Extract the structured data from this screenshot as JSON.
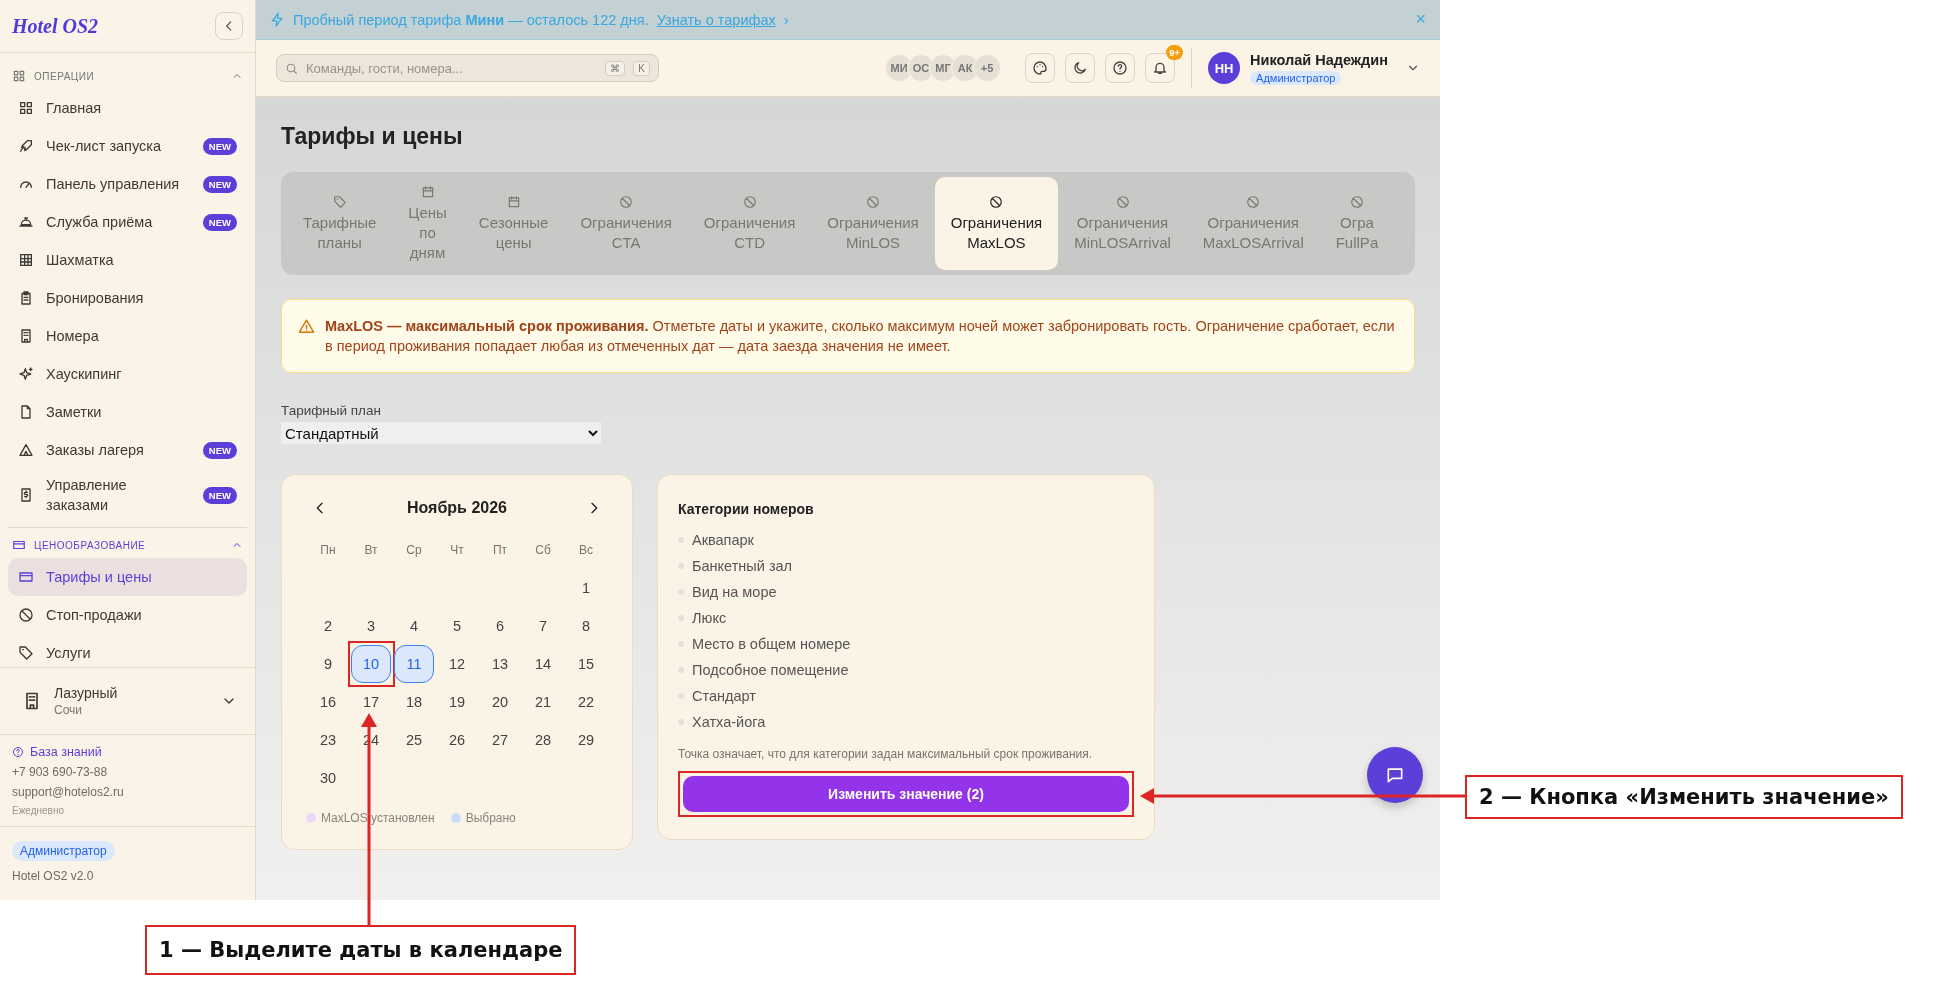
{
  "sidebar": {
    "logo": "Hotel OS2",
    "sections": [
      {
        "title": "ОПЕРАЦИИ",
        "expanded": true,
        "items": [
          {
            "label": "Главная",
            "selected": false
          },
          {
            "label": "Чек-лист запуска",
            "badge": "NEW",
            "selected": false
          },
          {
            "label": "Панель управления",
            "badge": "NEW",
            "selected": false
          },
          {
            "label": "Служба приёма",
            "badge": "NEW",
            "selected": false
          },
          {
            "label": "Шахматка",
            "selected": false
          },
          {
            "label": "Бронирования",
            "selected": false
          },
          {
            "label": "Номера",
            "selected": false
          },
          {
            "label": "Хаускипинг",
            "selected": false
          },
          {
            "label": "Заметки",
            "selected": false
          },
          {
            "label": "Заказы лагеря",
            "badge": "NEW",
            "selected": false
          },
          {
            "label": "Управление заказами",
            "badge": "NEW",
            "selected": false
          }
        ]
      },
      {
        "title": "ЦЕНООБРАЗОВАНИЕ",
        "expanded": true,
        "items": [
          {
            "label": "Тарифы и цены",
            "selected": true
          },
          {
            "label": "Стоп-продажи",
            "selected": false
          },
          {
            "label": "Услуги",
            "selected": false
          }
        ]
      }
    ],
    "property": {
      "name": "Лазурный",
      "city": "Сочи"
    },
    "help": {
      "link": "База знаний",
      "phone": "+7 903 690-73-88",
      "email": "support@hotelos2.ru",
      "hours": "Ежедневно"
    },
    "footer": {
      "role": "Администратор",
      "version": "Hotel OS2 v2.0"
    }
  },
  "banner": {
    "text": "Пробный период тарифа **Мини** — осталось 122 дня.",
    "link": "Узнать о тарифах",
    "link_arrow": "›",
    "close": "×"
  },
  "topbar": {
    "search": {
      "placeholder": "Команды, гости, номера..."
    },
    "keys": [
      "⌘",
      "K"
    ],
    "avatars": [
      "МИ",
      "ОС",
      "МГ",
      "АК",
      "+5"
    ],
    "notifications": "9+",
    "user": {
      "initials": "НН",
      "name": "Николай Надеждин",
      "role": "Администратор"
    }
  },
  "page": {
    "title": "Тарифы и цены",
    "tabs": [
      {
        "label": "Тарифные планы",
        "kind": "plans",
        "selected": false
      },
      {
        "label": "Цены по дням",
        "kind": "calendar",
        "selected": false
      },
      {
        "label": "Сезонные цены",
        "kind": "calendar",
        "selected": false
      },
      {
        "label": "Ограничения CTA",
        "kind": "restriction",
        "selected": false
      },
      {
        "label": "Ограничения CTD",
        "kind": "restriction",
        "selected": false
      },
      {
        "label": "Ограничения MinLOS",
        "kind": "restriction",
        "selected": false
      },
      {
        "label": "Ограничения MaxLOS",
        "kind": "restriction",
        "selected": true
      },
      {
        "label": "Ограничения MinLOSArrival",
        "kind": "restriction",
        "selected": false
      },
      {
        "label": "Ограничения MaxLOSArrival",
        "kind": "restriction",
        "selected": false
      },
      {
        "label": "Огра FullPa",
        "kind": "restriction",
        "selected": false
      }
    ],
    "alert": "**MaxLOS — максимальный срок проживания.** Отметьте даты и укажите, сколько максимум ночей может забронировать гость. Ограничение сработает, если в период проживания попадает любая из отмеченных дат — дата заезда значения не имеет.",
    "rate_plan": {
      "label": "Тарифный план",
      "value": "Стандартный"
    },
    "calendar": {
      "month": "Ноябрь 2026",
      "weekdays": [
        "Пн",
        "Вт",
        "Ср",
        "Чт",
        "Пт",
        "Сб",
        "Вс"
      ],
      "weeks": [
        [
          {
            "day": "1",
            "selected": false,
            "highlighted": false
          }
        ],
        [
          {
            "day": "2",
            "selected": false,
            "highlighted": false
          },
          {
            "day": "3",
            "selected": false,
            "highlighted": false
          },
          {
            "day": "4",
            "selected": false,
            "highlighted": false
          },
          {
            "day": "5",
            "selected": false,
            "highlighted": false
          },
          {
            "day": "6",
            "selected": false,
            "highlighted": false
          },
          {
            "day": "7",
            "selected": false,
            "highlighted": false
          },
          {
            "day": "8",
            "selected": false,
            "highlighted": false
          }
        ],
        [
          {
            "day": "9",
            "selected": false,
            "highlighted": false
          },
          {
            "day": "10",
            "selected": true,
            "highlighted": true
          },
          {
            "day": "11",
            "selected": true,
            "highlighted": false
          },
          {
            "day": "12",
            "selected": false,
            "highlighted": false
          },
          {
            "day": "13",
            "selected": false,
            "highlighted": false
          },
          {
            "day": "14",
            "selected": false,
            "highlighted": false
          },
          {
            "day": "15",
            "selected": false,
            "highlighted": false
          }
        ],
        [
          {
            "day": "16",
            "selected": false,
            "highlighted": false
          },
          {
            "day": "17",
            "selected": false,
            "highlighted": false
          },
          {
            "day": "18",
            "selected": false,
            "highlighted": false
          },
          {
            "day": "19",
            "selected": false,
            "highlighted": false
          },
          {
            "day": "20",
            "selected": false,
            "highlighted": false
          },
          {
            "day": "21",
            "selected": false,
            "highlighted": false
          },
          {
            "day": "22",
            "selected": false,
            "highlighted": false
          }
        ],
        [
          {
            "day": "23",
            "selected": false,
            "highlighted": false
          },
          {
            "day": "24",
            "selected": false,
            "highlighted": false
          },
          {
            "day": "25",
            "selected": false,
            "highlighted": false
          },
          {
            "day": "26",
            "selected": false,
            "highlighted": false
          },
          {
            "day": "27",
            "selected": false,
            "highlighted": false
          },
          {
            "day": "28",
            "selected": false,
            "highlighted": false
          },
          {
            "day": "29",
            "selected": false,
            "highlighted": false
          }
        ],
        [
          {
            "day": "30",
            "selected": false,
            "highlighted": false
          }
        ]
      ],
      "legend": [
        {
          "label": "MaxLOS установлен",
          "color": "#ead9fb"
        },
        {
          "label": "Выбрано",
          "color": "#c9dcf7"
        }
      ]
    },
    "categories": {
      "title": "Категории номеров",
      "items": [
        "Аквапарк",
        "Банкетный зал",
        "Вид на море",
        "Люкс",
        "Место в общем номере",
        "Подсобное помещение",
        "Стандарт",
        "Хатха-йога"
      ],
      "note": "Точка означает, что для категории задан максимальный срок проживания.",
      "button": {
        "label": "Изменить значение (2)",
        "highlighted": true
      }
    }
  },
  "annotations": [
    {
      "text": "1 — Выделите даты в календаре"
    },
    {
      "text": "2 — Кнопка «Изменить значение»"
    }
  ]
}
